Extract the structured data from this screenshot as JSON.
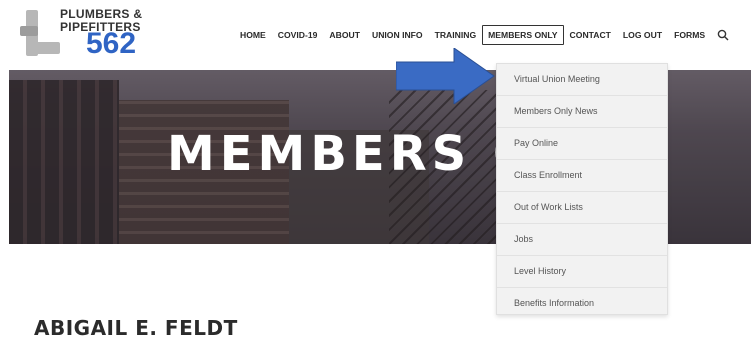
{
  "logo": {
    "line1": "PLUMBERS &",
    "line2": "PIPEFITTERS",
    "number": "562",
    "brand_color": "#2f64c4"
  },
  "nav": {
    "items": [
      {
        "label": "HOME"
      },
      {
        "label": "COVID-19"
      },
      {
        "label": "ABOUT"
      },
      {
        "label": "UNION INFO"
      },
      {
        "label": "TRAINING"
      },
      {
        "label": "MEMBERS ONLY",
        "active": true
      },
      {
        "label": "CONTACT"
      },
      {
        "label": "LOG OUT"
      },
      {
        "label": "FORMS"
      }
    ],
    "search_icon": "search-icon"
  },
  "hero": {
    "title": "MEMBERS O"
  },
  "annotation": {
    "arrow_color": "#3a6bc4"
  },
  "dropdown": {
    "items": [
      {
        "label": "Virtual Union Meeting"
      },
      {
        "label": "Members Only News"
      },
      {
        "label": "Pay Online"
      },
      {
        "label": "Class Enrollment"
      },
      {
        "label": "Out of Work Lists"
      },
      {
        "label": "Jobs"
      },
      {
        "label": "Level History"
      },
      {
        "label": "Benefits Information"
      }
    ]
  },
  "main": {
    "heading": "ABIGAIL E. FELDT"
  }
}
